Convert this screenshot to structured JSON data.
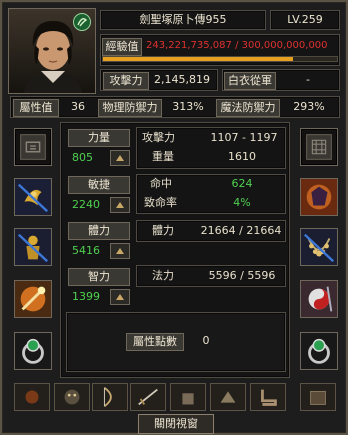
{
  "header": {
    "name": "劍聖塚原卜傳955",
    "level": "LV.259"
  },
  "exp": {
    "label": "經驗值",
    "current": "243,221,735,087",
    "sep": "/",
    "max": "300,000,000,000",
    "fill_fraction": 0.81
  },
  "top_stats": {
    "attack_label": "攻擊力",
    "attack_value": "2,145,819",
    "faction_label": "白衣從軍",
    "faction_value": "-"
  },
  "attrib_row": {
    "attr_label": "屬性值",
    "attr_value": "36",
    "phys_def_label": "物理防禦力",
    "phys_def_value": "313%",
    "mag_def_label": "魔法防禦力",
    "mag_def_value": "293%"
  },
  "base_stats": [
    {
      "label": "力量",
      "value": "805"
    },
    {
      "label": "敏捷",
      "value": "2240"
    },
    {
      "label": "體力",
      "value": "5416"
    },
    {
      "label": "智力",
      "value": "1399"
    }
  ],
  "detail": {
    "atk_label": "攻擊力",
    "atk_min": "1107",
    "atk_sep": "-",
    "atk_max": "1197",
    "weight_label": "重量",
    "weight_value": "1610",
    "hit_label": "命中",
    "hit_value": "624",
    "crit_label": "致命率",
    "crit_value": "4%",
    "hp_label": "體力",
    "hp_current": "21664",
    "hp_sep": "/",
    "hp_max": "21664",
    "mp_label": "法力",
    "mp_current": "5596",
    "mp_sep": "/",
    "mp_max": "5596"
  },
  "points": {
    "label": "屬性點數",
    "value": "0"
  },
  "footer": {
    "close_label": "關閉視窗"
  },
  "colors": {
    "green_value": "#4fd04f",
    "red_exp": "#e03030",
    "exp_bar": "#e8a020"
  },
  "icons": {
    "left_slots": [
      "seal-box-icon",
      "golden-bird-crossed-icon",
      "golden-warrior-crossed-icon",
      "fire-staff-icon",
      "jade-ring-icon"
    ],
    "right_slots": [
      "knot-box-icon",
      "dark-gem-icon",
      "bead-necklace-crossed-icon",
      "taiji-sword-icon",
      "jade-ring-icon"
    ],
    "toolbar": [
      "orb-icon",
      "mask-icon",
      "bow-icon",
      "sword-icon",
      "glove-icon",
      "gauntlet-icon",
      "boot-icon",
      "pouch-icon"
    ]
  }
}
